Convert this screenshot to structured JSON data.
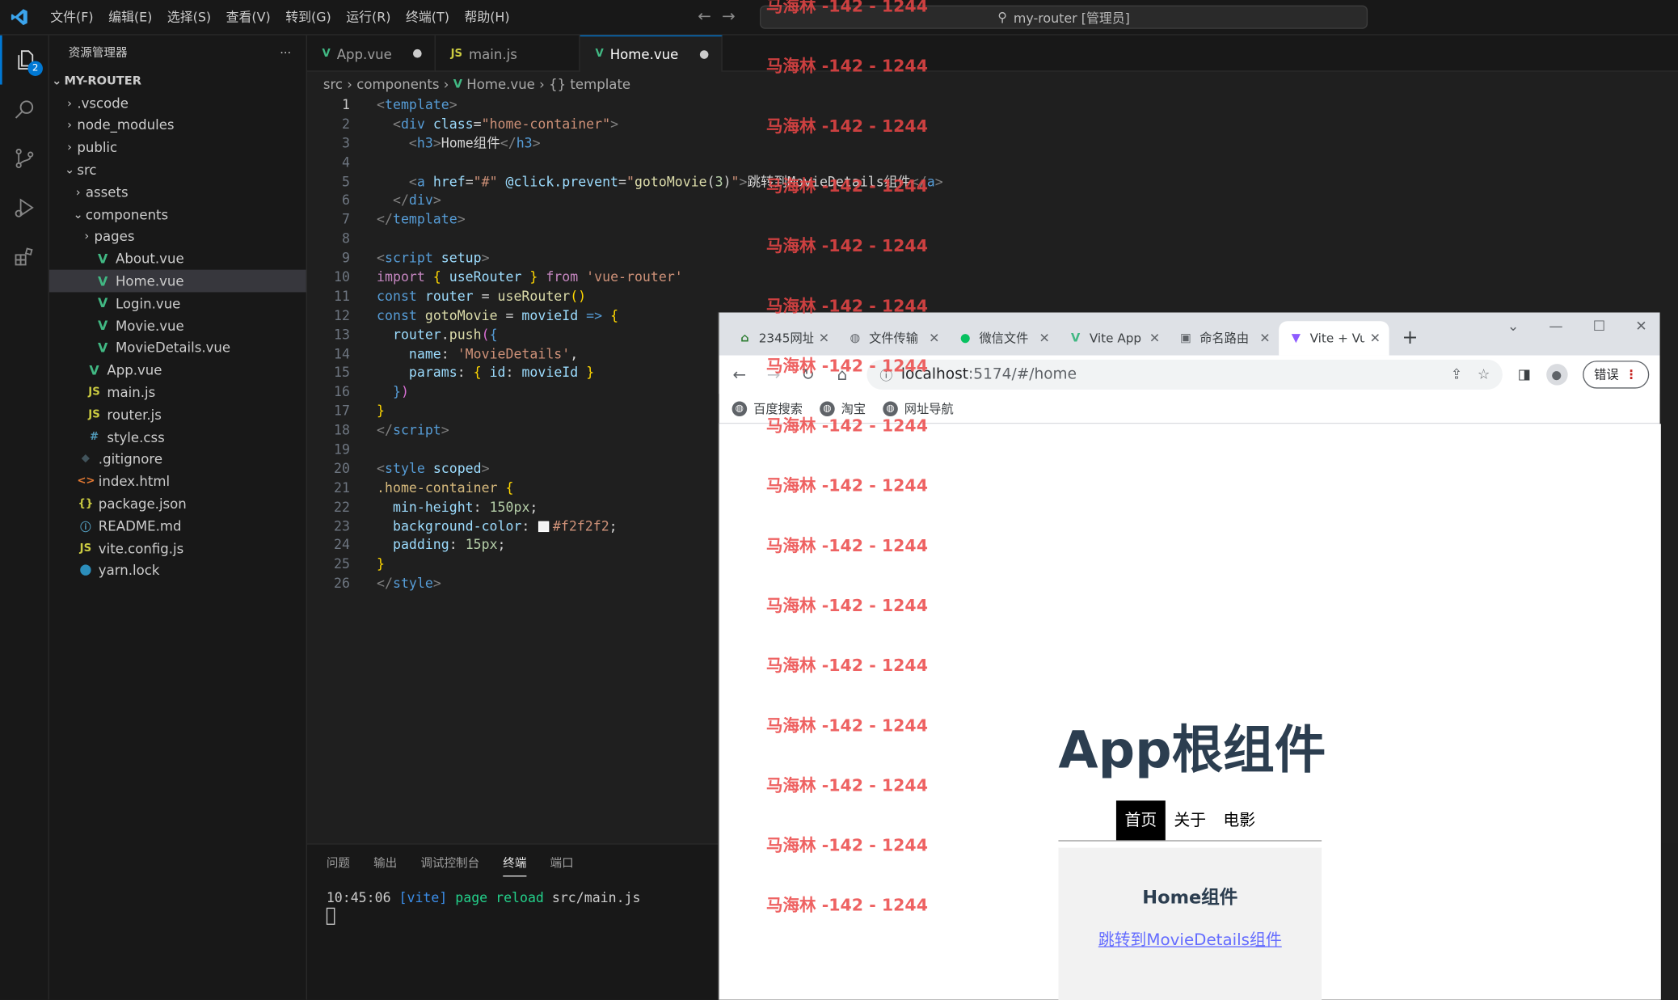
{
  "titlebar": {
    "menus": [
      "文件(F)",
      "编辑(E)",
      "选择(S)",
      "查看(V)",
      "转到(G)",
      "运行(R)",
      "终端(T)",
      "帮助(H)"
    ],
    "search": "my-router [管理员]"
  },
  "activity": {
    "badge": "2"
  },
  "sidebar": {
    "header": "资源管理器",
    "more": "···",
    "root": "MY-ROUTER",
    "items": [
      {
        "label": ".vscode",
        "kind": "folder-closed",
        "depth": 1
      },
      {
        "label": "node_modules",
        "kind": "folder-closed",
        "depth": 1
      },
      {
        "label": "public",
        "kind": "folder-closed",
        "depth": 1
      },
      {
        "label": "src",
        "kind": "folder-open",
        "depth": 1
      },
      {
        "label": "assets",
        "kind": "folder-closed",
        "depth": 2
      },
      {
        "label": "components",
        "kind": "folder-open",
        "depth": 2
      },
      {
        "label": "pages",
        "kind": "folder-closed",
        "depth": 3
      },
      {
        "label": "About.vue",
        "kind": "vue",
        "depth": 3
      },
      {
        "label": "Home.vue",
        "kind": "vue",
        "depth": 3,
        "selected": true
      },
      {
        "label": "Login.vue",
        "kind": "vue",
        "depth": 3
      },
      {
        "label": "Movie.vue",
        "kind": "vue",
        "depth": 3
      },
      {
        "label": "MovieDetails.vue",
        "kind": "vue",
        "depth": 3
      },
      {
        "label": "App.vue",
        "kind": "vue",
        "depth": 2
      },
      {
        "label": "main.js",
        "kind": "js",
        "depth": 2
      },
      {
        "label": "router.js",
        "kind": "js",
        "depth": 2
      },
      {
        "label": "style.css",
        "kind": "css",
        "depth": 2
      },
      {
        "label": ".gitignore",
        "kind": "git",
        "depth": 1
      },
      {
        "label": "index.html",
        "kind": "html",
        "depth": 1
      },
      {
        "label": "package.json",
        "kind": "json",
        "depth": 1
      },
      {
        "label": "README.md",
        "kind": "info",
        "depth": 1
      },
      {
        "label": "vite.config.js",
        "kind": "js",
        "depth": 1
      },
      {
        "label": "yarn.lock",
        "kind": "yarn",
        "depth": 1
      }
    ]
  },
  "editor": {
    "tabs": [
      {
        "label": "App.vue",
        "kind": "vue",
        "dirty": true,
        "active": false
      },
      {
        "label": "main.js",
        "kind": "js",
        "dirty": false,
        "active": false
      },
      {
        "label": "Home.vue",
        "kind": "vue",
        "dirty": true,
        "active": true
      }
    ],
    "breadcrumb": [
      "src",
      "components",
      "Home.vue",
      "{} template"
    ],
    "current_line": 1,
    "lines": [
      [
        [
          "t-tag",
          "<"
        ],
        [
          "t-name",
          "template"
        ],
        [
          "t-tag",
          ">"
        ]
      ],
      [
        [
          "t-txt",
          "  "
        ],
        [
          "t-tag",
          "<"
        ],
        [
          "t-name",
          "div"
        ],
        [
          "t-txt",
          " "
        ],
        [
          "t-attr",
          "class"
        ],
        [
          "t-punc",
          "="
        ],
        [
          "t-str",
          "\"home-container\""
        ],
        [
          "t-tag",
          ">"
        ]
      ],
      [
        [
          "t-txt",
          "    "
        ],
        [
          "t-tag",
          "<"
        ],
        [
          "t-name",
          "h3"
        ],
        [
          "t-tag",
          ">"
        ],
        [
          "t-txt",
          "Home组件"
        ],
        [
          "t-tag",
          "</"
        ],
        [
          "t-name",
          "h3"
        ],
        [
          "t-tag",
          ">"
        ]
      ],
      [],
      [
        [
          "t-txt",
          "    "
        ],
        [
          "t-tag",
          "<"
        ],
        [
          "t-name",
          "a"
        ],
        [
          "t-txt",
          " "
        ],
        [
          "t-attr",
          "href"
        ],
        [
          "t-punc",
          "="
        ],
        [
          "t-str",
          "\"#\""
        ],
        [
          "t-txt",
          " "
        ],
        [
          "t-attr",
          "@click.prevent"
        ],
        [
          "t-punc",
          "="
        ],
        [
          "t-str",
          "\""
        ],
        [
          "t-fn",
          "gotoMovie"
        ],
        [
          "t-punc",
          "("
        ],
        [
          "t-num",
          "3"
        ],
        [
          "t-punc",
          ")"
        ],
        [
          "t-str",
          "\""
        ],
        [
          "t-tag",
          ">"
        ],
        [
          "t-txt",
          "跳转到MovieDetails组件"
        ],
        [
          "t-tag",
          "</"
        ],
        [
          "t-name",
          "a"
        ],
        [
          "t-tag",
          ">"
        ]
      ],
      [
        [
          "t-txt",
          "  "
        ],
        [
          "t-tag",
          "</"
        ],
        [
          "t-name",
          "div"
        ],
        [
          "t-tag",
          ">"
        ]
      ],
      [
        [
          "t-tag",
          "</"
        ],
        [
          "t-name",
          "template"
        ],
        [
          "t-tag",
          ">"
        ]
      ],
      [],
      [
        [
          "t-tag",
          "<"
        ],
        [
          "t-name",
          "script"
        ],
        [
          "t-txt",
          " "
        ],
        [
          "t-attr",
          "setup"
        ],
        [
          "t-tag",
          ">"
        ]
      ],
      [
        [
          "t-kw",
          "import"
        ],
        [
          "t-txt",
          " "
        ],
        [
          "t-br",
          "{"
        ],
        [
          "t-txt",
          " "
        ],
        [
          "t-var",
          "useRouter"
        ],
        [
          "t-txt",
          " "
        ],
        [
          "t-br",
          "}"
        ],
        [
          "t-txt",
          " "
        ],
        [
          "t-kw",
          "from"
        ],
        [
          "t-txt",
          " "
        ],
        [
          "t-str",
          "'vue-router'"
        ]
      ],
      [
        [
          "t-kw2",
          "const"
        ],
        [
          "t-txt",
          " "
        ],
        [
          "t-var",
          "router"
        ],
        [
          "t-txt",
          " = "
        ],
        [
          "t-fn",
          "useRouter"
        ],
        [
          "t-br",
          "()"
        ]
      ],
      [
        [
          "t-kw2",
          "const"
        ],
        [
          "t-txt",
          " "
        ],
        [
          "t-fn",
          "gotoMovie"
        ],
        [
          "t-txt",
          " = "
        ],
        [
          "t-var",
          "movieId"
        ],
        [
          "t-txt",
          " "
        ],
        [
          "t-kw2",
          "=>"
        ],
        [
          "t-txt",
          " "
        ],
        [
          "t-br",
          "{"
        ]
      ],
      [
        [
          "t-txt",
          "  "
        ],
        [
          "t-var",
          "router"
        ],
        [
          "t-txt",
          "."
        ],
        [
          "t-fn",
          "push"
        ],
        [
          "t-br2",
          "("
        ],
        [
          "t-kw2",
          "{"
        ]
      ],
      [
        [
          "t-txt",
          "    "
        ],
        [
          "t-var",
          "name"
        ],
        [
          "t-txt",
          ": "
        ],
        [
          "t-str",
          "'MovieDetails'"
        ],
        [
          "t-txt",
          ","
        ]
      ],
      [
        [
          "t-txt",
          "    "
        ],
        [
          "t-var",
          "params"
        ],
        [
          "t-txt",
          ": "
        ],
        [
          "t-br",
          "{"
        ],
        [
          "t-txt",
          " "
        ],
        [
          "t-var",
          "id"
        ],
        [
          "t-txt",
          ": "
        ],
        [
          "t-var",
          "movieId"
        ],
        [
          "t-txt",
          " "
        ],
        [
          "t-br",
          "}"
        ]
      ],
      [
        [
          "t-txt",
          "  "
        ],
        [
          "t-kw2",
          "}"
        ],
        [
          "t-br2",
          ")"
        ]
      ],
      [
        [
          "t-br",
          "}"
        ]
      ],
      [
        [
          "t-tag",
          "</"
        ],
        [
          "t-name",
          "script"
        ],
        [
          "t-tag",
          ">"
        ]
      ],
      [],
      [
        [
          "t-tag",
          "<"
        ],
        [
          "t-name",
          "style"
        ],
        [
          "t-txt",
          " "
        ],
        [
          "t-attr",
          "scoped"
        ],
        [
          "t-tag",
          ">"
        ]
      ],
      [
        [
          "t-sel",
          ".home-container"
        ],
        [
          "t-txt",
          " "
        ],
        [
          "t-br",
          "{"
        ]
      ],
      [
        [
          "t-txt",
          "  "
        ],
        [
          "t-var",
          "min-height"
        ],
        [
          "t-txt",
          ": "
        ],
        [
          "t-num",
          "150px"
        ],
        [
          "t-txt",
          ";"
        ]
      ],
      [
        [
          "t-txt",
          "  "
        ],
        [
          "t-var",
          "background-color"
        ],
        [
          "t-txt",
          ": "
        ],
        [
          "swatch",
          ""
        ],
        [
          "t-str",
          "#f2f2f2"
        ],
        [
          "t-txt",
          ";"
        ]
      ],
      [
        [
          "t-txt",
          "  "
        ],
        [
          "t-var",
          "padding"
        ],
        [
          "t-txt",
          ": "
        ],
        [
          "t-num",
          "15px"
        ],
        [
          "t-txt",
          ";"
        ]
      ],
      [
        [
          "t-br",
          "}"
        ]
      ],
      [
        [
          "t-tag",
          "</"
        ],
        [
          "t-name",
          "style"
        ],
        [
          "t-tag",
          ">"
        ]
      ]
    ]
  },
  "panel": {
    "tabs": [
      "问题",
      "输出",
      "调试控制台",
      "终端",
      "端口"
    ],
    "active_tab": "终端",
    "terminal_time": "10:45:06",
    "terminal_tag": "[vite]",
    "terminal_msg": "page reload",
    "terminal_file": "src/main.js"
  },
  "browser": {
    "tabs": [
      {
        "label": "2345网址",
        "fav": "2345"
      },
      {
        "label": "文件传输",
        "fav": "globe"
      },
      {
        "label": "微信文件",
        "fav": "wechat"
      },
      {
        "label": "Vite App",
        "fav": "vue"
      },
      {
        "label": "命名路由",
        "fav": "img"
      },
      {
        "label": "Vite + Vue",
        "fav": "vite",
        "active": true
      }
    ],
    "new_tab": "+",
    "url_host": "localhost",
    "url_rest": ":5174/#/home",
    "error_label": "错误",
    "bookmarks": [
      "百度搜索",
      "淘宝",
      "网址导航"
    ],
    "app": {
      "title": "App根组件",
      "nav": [
        "首页",
        "关于",
        "电影"
      ],
      "active_nav": 0,
      "home_title": "Home组件",
      "home_link": "跳转到MovieDetails组件"
    }
  },
  "watermark": "马海林 -142 - 1244"
}
